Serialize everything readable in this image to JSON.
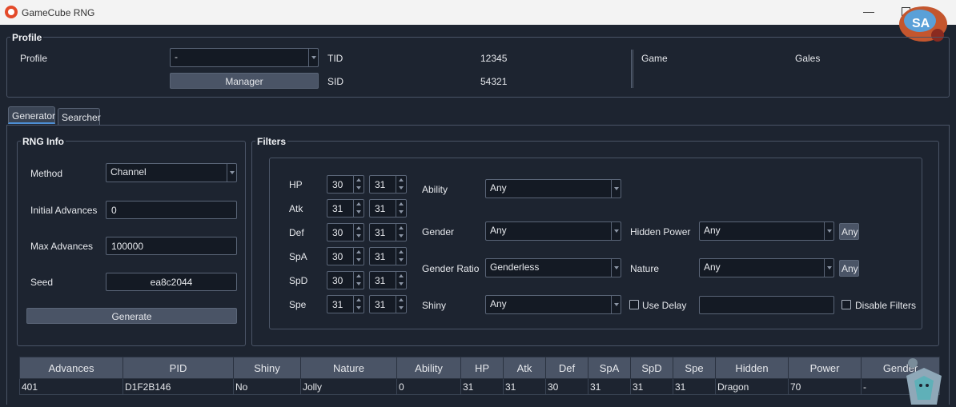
{
  "window": {
    "title": "GameCube RNG",
    "badge": "SA"
  },
  "profile": {
    "legend": "Profile",
    "profile_label": "Profile",
    "profile_value": "-",
    "manager_label": "Manager",
    "tid_label": "TID",
    "tid_value": "12345",
    "sid_label": "SID",
    "sid_value": "54321",
    "game_label": "Game",
    "game_value": "Gales"
  },
  "tabs": [
    {
      "label": "Generator"
    },
    {
      "label": "Searcher"
    }
  ],
  "rng": {
    "legend": "RNG Info",
    "method_label": "Method",
    "method_value": "Channel",
    "initial_label": "Initial Advances",
    "initial_value": "0",
    "max_label": "Max Advances",
    "max_value": "100000",
    "seed_label": "Seed",
    "seed_value": "ea8c2044",
    "generate_label": "Generate"
  },
  "filters": {
    "legend": "Filters",
    "ivs": [
      {
        "label": "HP",
        "min": "30",
        "max": "31"
      },
      {
        "label": "Atk",
        "min": "31",
        "max": "31"
      },
      {
        "label": "Def",
        "min": "30",
        "max": "31"
      },
      {
        "label": "SpA",
        "min": "30",
        "max": "31"
      },
      {
        "label": "SpD",
        "min": "30",
        "max": "31"
      },
      {
        "label": "Spe",
        "min": "31",
        "max": "31"
      }
    ],
    "ability_label": "Ability",
    "ability_value": "Any",
    "gender_label": "Gender",
    "gender_value": "Any",
    "gender_ratio_label": "Gender Ratio",
    "gender_ratio_value": "Genderless",
    "shiny_label": "Shiny",
    "shiny_value": "Any",
    "hidden_power_label": "Hidden Power",
    "hidden_power_value": "Any",
    "hidden_power_any": "Any",
    "nature_label": "Nature",
    "nature_value": "Any",
    "nature_any": "Any",
    "use_delay_label": "Use Delay",
    "disable_filters_label": "Disable Filters"
  },
  "results": {
    "headers": [
      "Advances",
      "PID",
      "Shiny",
      "Nature",
      "Ability",
      "HP",
      "Atk",
      "Def",
      "SpA",
      "SpD",
      "Spe",
      "Hidden",
      "Power",
      "Gender"
    ],
    "rows": [
      [
        "401",
        "D1F2B146",
        "No",
        "Jolly",
        "0",
        "31",
        "31",
        "30",
        "31",
        "31",
        "31",
        "Dragon",
        "70",
        "-"
      ]
    ]
  },
  "colors": {
    "background": "#1d2430",
    "accent": "#4d8fd6",
    "button": "#4a5466"
  }
}
